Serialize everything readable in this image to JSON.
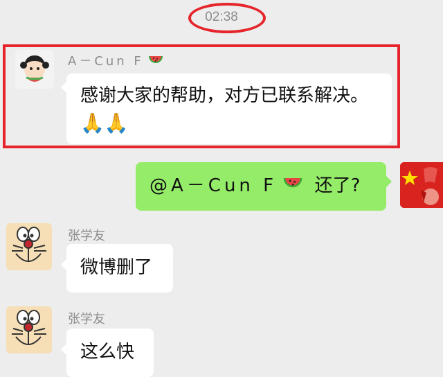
{
  "timestamp": "02:38",
  "messages": [
    {
      "sender": "A－Cun F",
      "text": "感谢大家的帮助，对方已联系解决。",
      "emoji_line": "🙏🙏"
    },
    {
      "mention": "@A－Cun F",
      "text": "还了?"
    },
    {
      "sender": "张学友",
      "text": "微博删了"
    },
    {
      "sender": "张学友",
      "text": "这么快"
    }
  ],
  "colors": {
    "background": "#ededed",
    "bubble_in": "#ffffff",
    "bubble_out": "#95ec69",
    "annotation_red": "#e5252b"
  },
  "icons": [
    "watermelon-icon",
    "praying-hands-icon",
    "avatar-girl",
    "avatar-doraemon",
    "avatar-china-flag"
  ]
}
